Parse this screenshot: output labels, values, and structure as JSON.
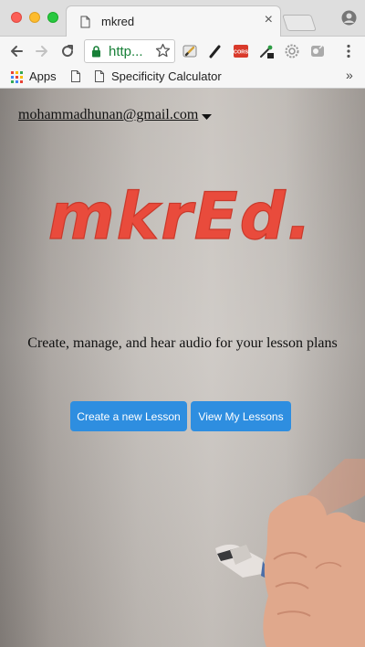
{
  "browser": {
    "tab_title": "mkred",
    "tab_close": "×",
    "url": "http...",
    "bookmarks": {
      "apps_label": "Apps",
      "item_label": "Specificity Calculator",
      "overflow": "»"
    },
    "extensions": [
      "pencil-extension-icon",
      "pen-extension-icon",
      "cors-extension-icon",
      "eyedropper-extension-icon",
      "settings-extension-icon",
      "toggle-extension-icon"
    ],
    "cors_badge": "CORS"
  },
  "page": {
    "account_email": "mohammadhunan@gmail.com",
    "logo_text": "mkrEd.",
    "logo_color": "#e94b3c",
    "tagline": "Create, manage, and hear audio for your lesson plans",
    "buttons": {
      "create": "Create a new Lesson",
      "view": "View My Lessons"
    },
    "button_color": "#2e8ee0"
  }
}
